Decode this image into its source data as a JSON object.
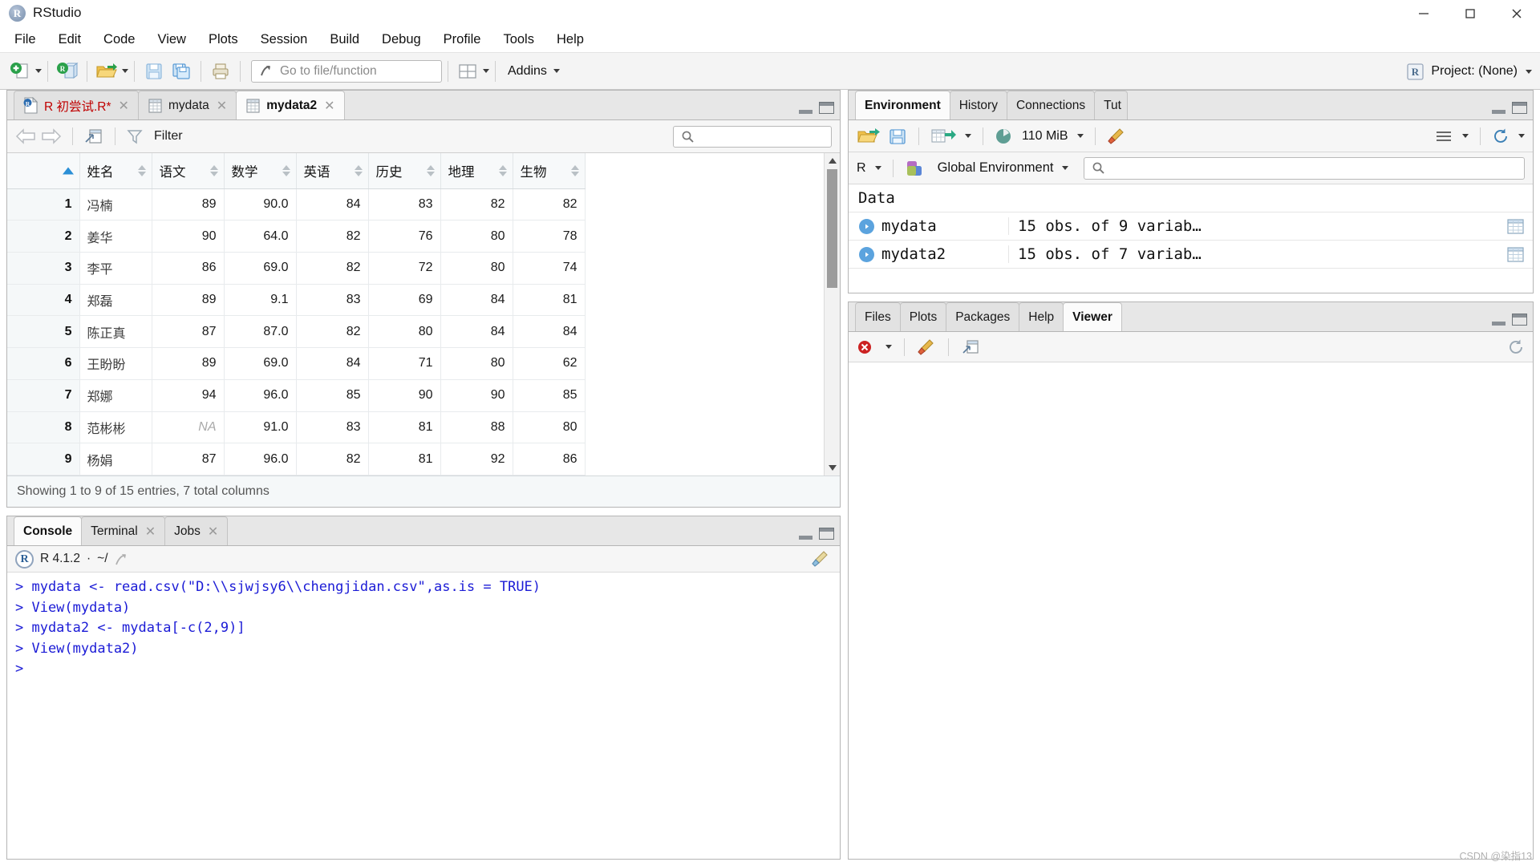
{
  "window": {
    "title": "RStudio",
    "logo_text": "R",
    "controls": [
      "minimize",
      "maximize",
      "close"
    ]
  },
  "menu": {
    "items": [
      "File",
      "Edit",
      "Code",
      "View",
      "Plots",
      "Session",
      "Build",
      "Debug",
      "Profile",
      "Tools",
      "Help"
    ]
  },
  "toolbar": {
    "new_file_icon": "new-file-icon",
    "new_project_icon": "new-project-icon",
    "open_icon": "open-folder-icon",
    "save_icon": "save-icon",
    "save_all_icon": "save-all-icon",
    "print_icon": "print-icon",
    "goto_placeholder": "Go to file/function",
    "workspace_panes_icon": "workspace-panes-icon",
    "addins_label": "Addins",
    "project_label": "Project: (None)",
    "project_icon": "r-project-icon"
  },
  "source_pane": {
    "tabs": [
      {
        "label": "R 初尝试.R*",
        "icon": "r-script-icon",
        "active": false,
        "closable": true,
        "modified": true
      },
      {
        "label": "mydata",
        "icon": "data-grid-icon",
        "active": false,
        "closable": true
      },
      {
        "label": "mydata2",
        "icon": "data-grid-icon",
        "active": true,
        "closable": true
      }
    ],
    "viewer_toolbar": {
      "back_icon": "back-arrow-icon",
      "forward_icon": "forward-arrow-icon",
      "popout_icon": "open-in-new-window-icon",
      "filter_icon": "filter-funnel-icon",
      "filter_label": "Filter",
      "search_icon": "search-icon",
      "search_value": ""
    },
    "status": "Showing 1 to 9 of 15 entries, 7 total columns"
  },
  "data_table": {
    "row_header_label": "",
    "sorted_column_index": 0,
    "sort_direction": "asc",
    "columns": [
      "姓名",
      "语文",
      "数学",
      "英语",
      "历史",
      "地理",
      "生物"
    ],
    "rows": [
      {
        "index": "1",
        "cells": [
          "冯楠",
          "89",
          "90.0",
          "84",
          "83",
          "82",
          "82"
        ]
      },
      {
        "index": "2",
        "cells": [
          "姜华",
          "90",
          "64.0",
          "82",
          "76",
          "80",
          "78"
        ]
      },
      {
        "index": "3",
        "cells": [
          "李平",
          "86",
          "69.0",
          "82",
          "72",
          "80",
          "74"
        ]
      },
      {
        "index": "4",
        "cells": [
          "郑磊",
          "89",
          "9.1",
          "83",
          "69",
          "84",
          "81"
        ]
      },
      {
        "index": "5",
        "cells": [
          "陈正真",
          "87",
          "87.0",
          "82",
          "80",
          "84",
          "84"
        ]
      },
      {
        "index": "6",
        "cells": [
          "王盼盼",
          "89",
          "69.0",
          "84",
          "71",
          "80",
          "62"
        ]
      },
      {
        "index": "7",
        "cells": [
          "郑娜",
          "94",
          "96.0",
          "85",
          "90",
          "90",
          "85"
        ]
      },
      {
        "index": "8",
        "cells": [
          "范彬彬",
          "NA",
          "91.0",
          "83",
          "81",
          "88",
          "80"
        ]
      },
      {
        "index": "9",
        "cells": [
          "杨娟",
          "87",
          "96.0",
          "82",
          "81",
          "92",
          "86"
        ]
      }
    ],
    "na_cells": [
      {
        "row": 7,
        "col": 1
      }
    ]
  },
  "console": {
    "tabs": [
      {
        "label": "Console",
        "active": true,
        "closable": false
      },
      {
        "label": "Terminal",
        "active": false,
        "closable": true
      },
      {
        "label": "Jobs",
        "active": false,
        "closable": true
      }
    ],
    "version": "R 4.1.2",
    "separator": "·",
    "working_dir": "~/",
    "popout_icon": "popout-icon",
    "clear_icon": "broom-clear-icon",
    "lines": [
      "> mydata <- read.csv(\"D:\\\\sjwjsy6\\\\chengjidan.csv\",as.is = TRUE)",
      "> View(mydata)",
      "> mydata2 <- mydata[-c(2,9)]",
      "> View(mydata2)",
      ">"
    ]
  },
  "environment_pane": {
    "tabs": [
      {
        "label": "Environment",
        "active": true
      },
      {
        "label": "History",
        "active": false
      },
      {
        "label": "Connections",
        "active": false
      },
      {
        "label": "Tut",
        "active": false
      }
    ],
    "toolbar": {
      "load_icon": "load-workspace-icon",
      "save_icon": "save-workspace-icon",
      "import_icon": "import-dataset-icon",
      "memory_icon": "memory-pie-icon",
      "memory_label": "110 MiB",
      "broom_icon": "broom-clear-icon",
      "list_view_icon": "list-view-icon",
      "refresh_icon": "refresh-icon"
    },
    "language_label": "R",
    "scope_label": "Global Environment",
    "scope_icon": "global-env-icon",
    "search_icon": "search-icon",
    "search_value": "",
    "sections": [
      {
        "title": "Data",
        "items": [
          {
            "name": "mydata",
            "value": "15 obs. of 9 variab…",
            "grid_icon": "view-data-icon"
          },
          {
            "name": "mydata2",
            "value": "15 obs. of 7 variab…",
            "grid_icon": "view-data-icon"
          }
        ]
      }
    ]
  },
  "files_pane": {
    "tabs": [
      {
        "label": "Files",
        "active": false
      },
      {
        "label": "Plots",
        "active": false
      },
      {
        "label": "Packages",
        "active": false
      },
      {
        "label": "Help",
        "active": false
      },
      {
        "label": "Viewer",
        "active": true
      }
    ],
    "toolbar": {
      "stop_icon": "stop-icon",
      "broom_icon": "broom-clear-icon",
      "popout_icon": "popout-icon",
      "refresh_icon": "refresh-icon"
    }
  },
  "watermark": "CSDN @染指13",
  "colors": {
    "accent_blue": "#2b8fd6",
    "console_text": "#1b1bd6",
    "tab_modified_red": "#c00000",
    "toolbar_bg": "#f4f4f4",
    "pane_border": "#b5b5b5"
  }
}
